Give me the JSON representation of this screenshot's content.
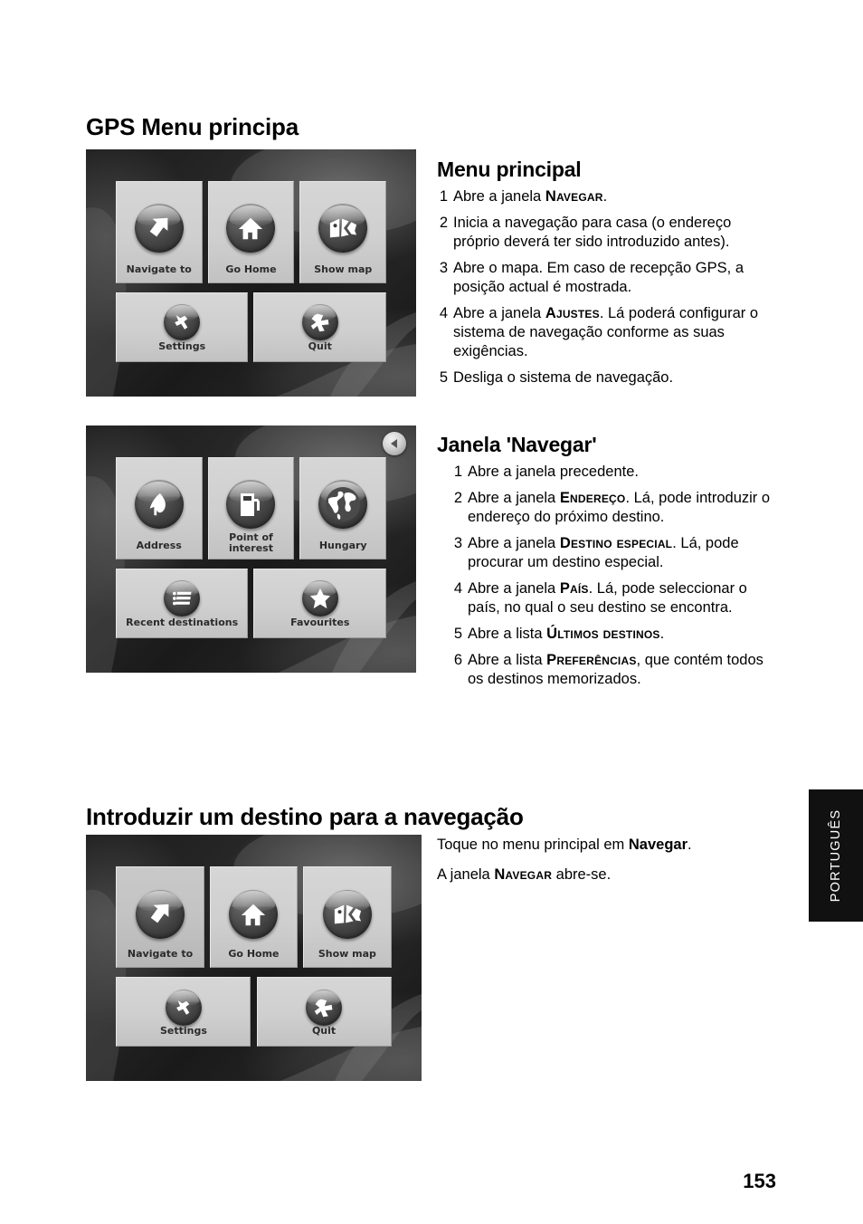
{
  "page": {
    "number": "153",
    "language_tab": "PORTUGUÊS"
  },
  "sections": {
    "main_heading": "GPS Menu principa",
    "menu_principal": {
      "heading": "Menu principal",
      "items": [
        {
          "num": "1",
          "pre": "Abre a janela ",
          "em": "Navegar",
          "post": "."
        },
        {
          "num": "2",
          "pre": "Inicia a navegação para casa (o endereço próprio deverá ter sido introduzido antes).",
          "em": "",
          "post": ""
        },
        {
          "num": "3",
          "pre": "Abre o mapa. Em caso de recepção GPS, a posição actual é mostrada.",
          "em": "",
          "post": ""
        },
        {
          "num": "4",
          "pre": "Abre a janela ",
          "em": "Ajustes",
          "post": ". Lá poderá configurar o sistema de navegação conforme as suas exigências."
        },
        {
          "num": "5",
          "pre": "Desliga o sistema de navegação.",
          "em": "",
          "post": ""
        }
      ]
    },
    "janela_navegar": {
      "heading": "Janela 'Navegar'",
      "items": [
        {
          "num": "1",
          "pre": "Abre a janela precedente.",
          "em": "",
          "post": ""
        },
        {
          "num": "2",
          "pre": "Abre a janela ",
          "em": "Endereço",
          "post": ". Lá, pode introduzir o endereço do próximo destino."
        },
        {
          "num": "3",
          "pre": "Abre a janela ",
          "em": "Destino especial",
          "post": ". Lá, pode procurar um destino especial."
        },
        {
          "num": "4",
          "pre": "Abre a janela ",
          "em": "País",
          "post": ". Lá, pode seleccionar o país, no qual o seu destino se encontra."
        },
        {
          "num": "5",
          "pre": "Abre a lista ",
          "em": "Últimos destinos",
          "post": "."
        },
        {
          "num": "6",
          "pre": "Abre a lista ",
          "em": "Preferências",
          "post": ", que contém todos os destinos memorizados."
        }
      ]
    },
    "introduzir_destino": {
      "heading": "Introduzir um destino para a navegação",
      "paragraph1_pre": "Toque no menu principal em ",
      "paragraph1_em": "Navegar",
      "paragraph1_post": ".",
      "paragraph2_pre": "A janela ",
      "paragraph2_em": "Navegar",
      "paragraph2_post": " abre-se."
    }
  },
  "screenshots": {
    "main_menu": {
      "tiles": [
        {
          "label": "Navigate to",
          "icon": "arrow-up-right-icon"
        },
        {
          "label": "Go Home",
          "icon": "house-icon"
        },
        {
          "label": "Show map",
          "icon": "folded-map-icon"
        },
        {
          "label": "Settings",
          "icon": "wrench-icon"
        },
        {
          "label": "Quit",
          "icon": "cross-x-icon"
        }
      ]
    },
    "navigate_menu": {
      "back_button": "back-arrow-icon",
      "tiles": [
        {
          "label": "Address",
          "icon": "map-pin-flag-icon"
        },
        {
          "label": "Point of\ninterest",
          "icon": "fuel-pump-icon"
        },
        {
          "label": "Hungary",
          "icon": "globe-icon"
        },
        {
          "label": "Recent destinations",
          "icon": "list-lines-icon"
        },
        {
          "label": "Favourites",
          "icon": "star-icon"
        }
      ]
    },
    "main_menu_2": {
      "tiles": [
        {
          "label": "Navigate to",
          "icon": "arrow-up-right-icon"
        },
        {
          "label": "Go Home",
          "icon": "house-icon"
        },
        {
          "label": "Show map",
          "icon": "folded-map-icon"
        },
        {
          "label": "Settings",
          "icon": "wrench-icon"
        },
        {
          "label": "Quit",
          "icon": "cross-x-icon"
        }
      ]
    }
  },
  "colors": {
    "page_bg": "#ffffff",
    "text": "#000000",
    "tab_bg": "#111111",
    "tab_text": "#ffffff",
    "tile_bg": "#cfcfcf",
    "orb_dark": "#3a3a3a"
  }
}
